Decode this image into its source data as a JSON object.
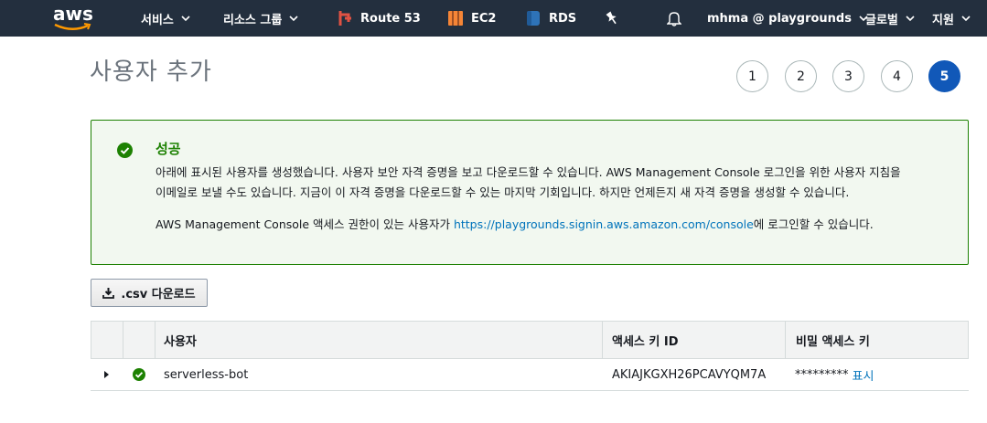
{
  "nav": {
    "logo_text": "aws",
    "services": "서비스",
    "resource_groups": "리소스 그룹",
    "route53": "Route 53",
    "ec2": "EC2",
    "rds": "RDS",
    "account": "mhma @ playgrounds",
    "region": "글로벌",
    "support": "지원"
  },
  "page": {
    "title": "사용자 추가"
  },
  "steps": [
    "1",
    "2",
    "3",
    "4",
    "5"
  ],
  "active_step": "5",
  "success": {
    "title": "성공",
    "line1": "아래에 표시된 사용자를 생성했습니다. 사용자 보안 자격 증명을 보고 다운로드할 수 있습니다. AWS Management Console 로그인을 위한 사용자 지침을",
    "line2": "이메일로 보낼 수도 있습니다. 지금이 이 자격 증명을 다운로드할 수 있는 마지막 기회입니다. 하지만 언제든지 새 자격 증명을 생성할 수 있습니다.",
    "line3_prefix": "AWS Management Console 액세스 권한이 있는 사용자가 ",
    "line3_link": "https://playgrounds.signin.aws.amazon.com/console",
    "line3_suffix": "에 로그인할 수 있습니다."
  },
  "download_button": ".csv 다운로드",
  "table": {
    "headers": {
      "user": "사용자",
      "access_key": "액세스 키 ID",
      "secret_key": "비밀 액세스 키"
    },
    "rows": [
      {
        "user": "serverless-bot",
        "access_key": "AKIAJKGXH26PCAVYQM7A",
        "secret_masked": "*********",
        "show_link": "표시"
      }
    ]
  },
  "colors": {
    "nav_bg": "#232f3e",
    "success_green": "#1d8102",
    "link_blue": "#0073bb",
    "active_step": "#1158b8",
    "aws_orange": "#ff9900"
  }
}
